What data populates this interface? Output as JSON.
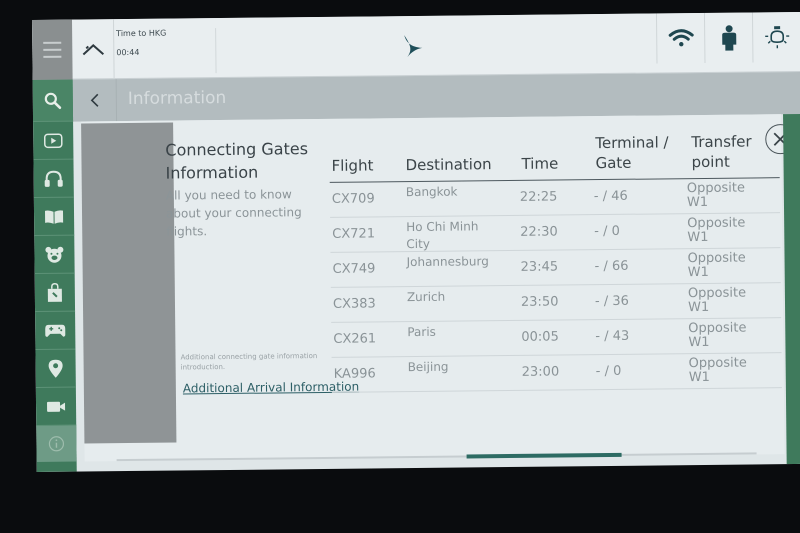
{
  "header": {
    "time_to_label": "Time to HKG",
    "time_to_value": "00:44",
    "icons": [
      "menu-icon",
      "home-icon",
      "airline-logo",
      "wifi-icon",
      "attendant-call-icon",
      "reading-light-icon"
    ]
  },
  "subheader": {
    "title": "Information"
  },
  "sidebar": {
    "items": [
      {
        "name": "search",
        "icon": "search-icon"
      },
      {
        "name": "movies",
        "icon": "play-icon"
      },
      {
        "name": "music",
        "icon": "headphones-icon"
      },
      {
        "name": "reading",
        "icon": "book-icon"
      },
      {
        "name": "kids",
        "icon": "bear-icon"
      },
      {
        "name": "shopping",
        "icon": "shopping-bag-icon"
      },
      {
        "name": "games",
        "icon": "gamepad-icon"
      },
      {
        "name": "map",
        "icon": "location-pin-icon"
      },
      {
        "name": "video",
        "icon": "camera-icon"
      },
      {
        "name": "info",
        "icon": "info-icon"
      }
    ]
  },
  "intro": {
    "title": "Connecting Gates Information",
    "description": "All you need to know about your connecting flights.",
    "note": "Additional connecting gate information introduction.",
    "link": "Additional Arrival Information"
  },
  "table": {
    "headers": {
      "flight": "Flight",
      "destination": "Destination",
      "time": "Time",
      "gate_line1": "Terminal /",
      "gate_line2": "Gate",
      "transfer_line1": "Transfer",
      "transfer_line2": "point"
    },
    "rows": [
      {
        "flight": "CX709",
        "destination": "Bangkok",
        "time": "22:25",
        "gate": "- / 46",
        "transfer": "Opposite W1"
      },
      {
        "flight": "CX721",
        "destination": "Ho Chi Minh City",
        "time": "22:30",
        "gate": "- / 0",
        "transfer": "Opposite W1"
      },
      {
        "flight": "CX749",
        "destination": "Johannesburg",
        "time": "23:45",
        "gate": "- / 66",
        "transfer": "Opposite W1"
      },
      {
        "flight": "CX383",
        "destination": "Zurich",
        "time": "23:50",
        "gate": "- / 36",
        "transfer": "Opposite W1"
      },
      {
        "flight": "CX261",
        "destination": "Paris",
        "time": "00:05",
        "gate": "- / 43",
        "transfer": "Opposite W1"
      },
      {
        "flight": "KA996",
        "destination": "Beijing",
        "time": "23:00",
        "gate": "- / 0",
        "transfer": "Opposite W1"
      }
    ]
  },
  "colors": {
    "brand_green": "#3f7a5c",
    "accent_teal": "#2d6b63"
  }
}
